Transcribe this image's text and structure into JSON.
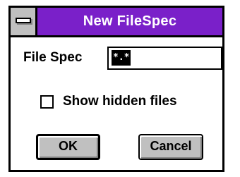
{
  "window": {
    "title": "New FileSpec",
    "title_bar_color": "#7a20c9",
    "system_menu_icon": "system-menu-icon"
  },
  "form": {
    "file_spec_label": "File Spec",
    "file_spec_value": "*.*"
  },
  "options": {
    "show_hidden_label": "Show hidden files",
    "show_hidden_checked": false
  },
  "buttons": {
    "ok_label": "OK",
    "cancel_label": "Cancel"
  }
}
